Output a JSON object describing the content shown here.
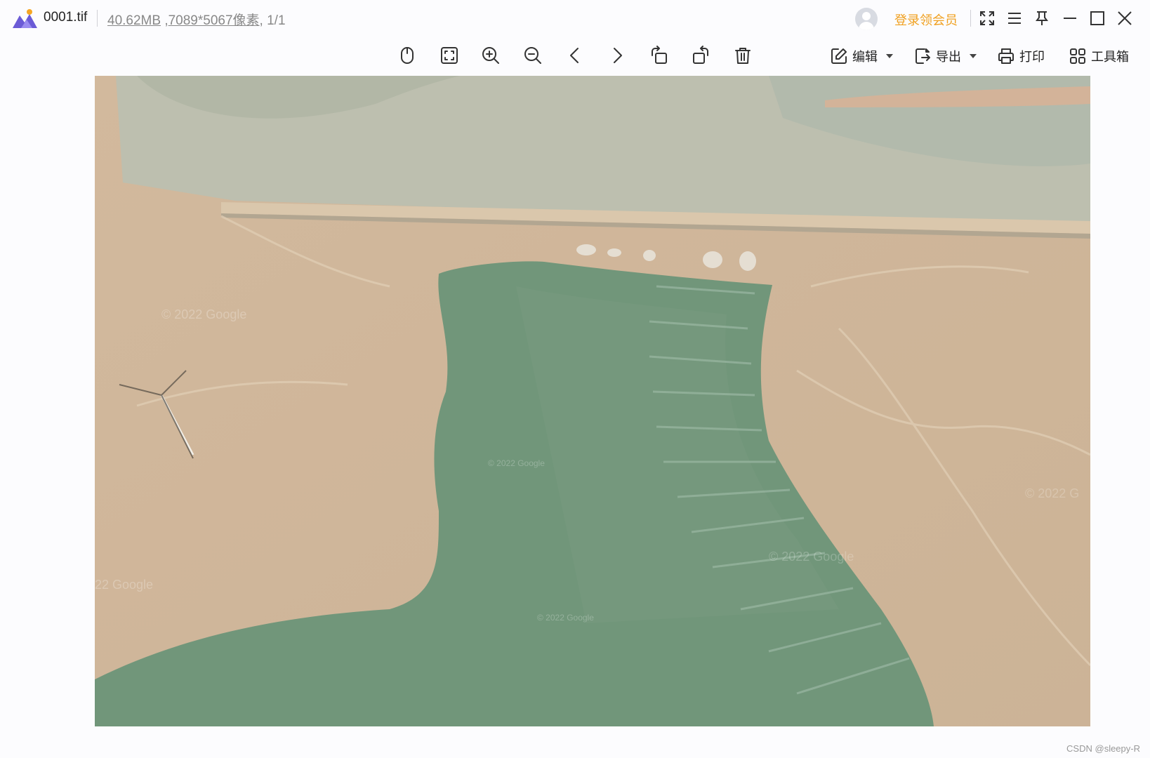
{
  "titlebar": {
    "filename": "0001.tif",
    "file_size": "40.62MB",
    "dimensions": "7089*5067像素",
    "page_info": ", 1/1",
    "vip_label": "登录领会员"
  },
  "toolbar": {
    "edit_label": "编辑",
    "export_label": "导出",
    "print_label": "打印",
    "tools_label": "工具箱"
  },
  "image": {
    "watermarks": [
      "© 2022 Google",
      "© 2022 Google",
      "© 2022 Google",
      "© 2022 Google",
      "22 Google",
      "© 2022 G"
    ]
  },
  "footer": {
    "credit": "CSDN @sleepy-R"
  },
  "colors": {
    "accent": "#f0a020",
    "logo_purple": "#6b5bd6",
    "logo_orange": "#f6a623",
    "water": "#5f8a6c",
    "land": "#c9ae8e"
  }
}
